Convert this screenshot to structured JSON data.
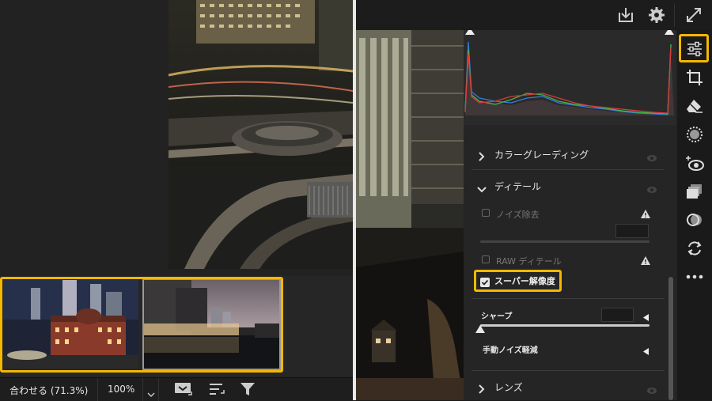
{
  "bottom_bar": {
    "fit_label": "合わせる (71.3%)",
    "zoom_label": "100%"
  },
  "icons": {
    "export": "download-tray-icon",
    "settings": "gear-icon",
    "fullscreen": "expand-arrows-icon",
    "tools": [
      "sliders-icon",
      "crop-icon",
      "eraser-icon",
      "mask-circle-icon",
      "red-eye-icon",
      "layers-icon",
      "presets-icon",
      "sync-icon",
      "more-dots-icon"
    ]
  },
  "panel": {
    "color_grading": "カラーグレーディング",
    "detail": "ディテール",
    "noise_removal": "ノイズ除去",
    "raw_detail": "RAW ディテール",
    "super_resolution": "スーパー解像度",
    "sharpen": "シャープ",
    "manual_noise": "手動ノイズ軽減",
    "lens": "レンズ"
  },
  "checkboxes": {
    "noise_removal": false,
    "raw_detail": false,
    "super_resolution": true
  },
  "colors": {
    "highlight": "#f5b800",
    "panel_bg": "#252525"
  }
}
